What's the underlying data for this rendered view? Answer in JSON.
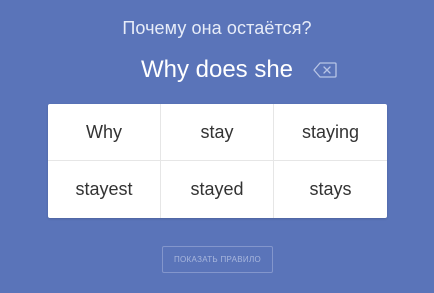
{
  "prompt": "Почему она остаётся?",
  "answer": "Why does she",
  "icons": {
    "backspace": "backspace-icon"
  },
  "options": [
    "Why",
    "stay",
    "staying",
    "stayest",
    "stayed",
    "stays"
  ],
  "rule_button": "ПОКАЗАТЬ ПРАВИЛО",
  "colors": {
    "background": "#5a74b9",
    "card": "#ffffff",
    "option_text": "#333333"
  }
}
